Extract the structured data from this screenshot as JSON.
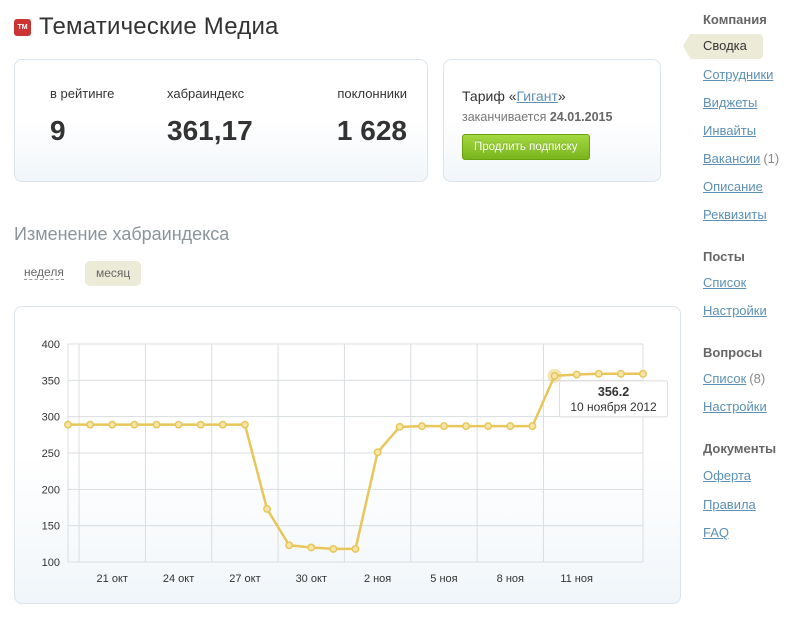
{
  "header": {
    "logo_text": "ТМ",
    "title": "Тематические Медиа"
  },
  "stats": {
    "rating_label": "в рейтинге",
    "rating_value": "9",
    "index_label": "хабраиндекс",
    "index_value": "361,17",
    "fans_label": "поклонники",
    "fans_value": "1 628"
  },
  "tariff": {
    "prefix": "Тариф «",
    "name": "Гигант",
    "suffix": "»",
    "expires_label": "заканчивается",
    "expires_date": "24.01.2015",
    "renew_label": "Продлить подписку"
  },
  "chart_section": {
    "title": "Изменение хабраиндекса",
    "period_week": "неделя",
    "period_month": "месяц"
  },
  "sidebar": {
    "company_heading": "Компания",
    "company_items": [
      {
        "label": "Сводка",
        "active": true
      },
      {
        "label": "Сотрудники"
      },
      {
        "label": "Виджеты"
      },
      {
        "label": "Инвайты"
      },
      {
        "label": "Вакансии",
        "count": "(1)"
      },
      {
        "label": "Описание"
      },
      {
        "label": "Реквизиты"
      }
    ],
    "posts_heading": "Посты",
    "posts_items": [
      {
        "label": "Список"
      },
      {
        "label": "Настройки"
      }
    ],
    "questions_heading": "Вопросы",
    "questions_items": [
      {
        "label": "Список",
        "count": "(8)"
      },
      {
        "label": "Настройки"
      }
    ],
    "docs_heading": "Документы",
    "docs_items": [
      {
        "label": "Оферта"
      },
      {
        "label": "Правила"
      },
      {
        "label": "FAQ"
      }
    ]
  },
  "colors": {
    "line": "#e8c65a",
    "point_fill": "#f5e6a8",
    "grid": "#d9dde0",
    "link": "#5c90b5",
    "button": "#8cc63f"
  },
  "chart_data": {
    "type": "line",
    "x": [
      "19 окт",
      "20 окт",
      "21 окт",
      "22 окт",
      "23 окт",
      "24 окт",
      "25 окт",
      "26 окт",
      "27 окт",
      "28 окт",
      "29 окт",
      "30 окт",
      "31 окт",
      "1 ноя",
      "2 ноя",
      "3 ноя",
      "4 ноя",
      "5 ноя",
      "6 ноя",
      "7 ноя",
      "8 ноя",
      "9 ноя",
      "10 ноя",
      "11 ноя",
      "12 ноя",
      "13 ноя",
      "14 ноя"
    ],
    "values": [
      289,
      289,
      289,
      289,
      289,
      289,
      289,
      289,
      289,
      173,
      123,
      120,
      118,
      118,
      251,
      286,
      287,
      287,
      287,
      287,
      287,
      287,
      356.2,
      358,
      359,
      359,
      359
    ],
    "x_tick_labels": [
      "21 окт",
      "24 окт",
      "27 окт",
      "30 окт",
      "2 ноя",
      "5 ноя",
      "8 ноя",
      "11 ноя"
    ],
    "x_tick_indices": [
      2,
      5,
      8,
      11,
      14,
      17,
      20,
      23
    ],
    "y_ticks": [
      100,
      150,
      200,
      250,
      300,
      350,
      400
    ],
    "ylim": [
      100,
      400
    ],
    "grid": true,
    "highlight_index": 22,
    "tooltip": {
      "value": "356.2",
      "date": "10 ноября 2012"
    }
  }
}
